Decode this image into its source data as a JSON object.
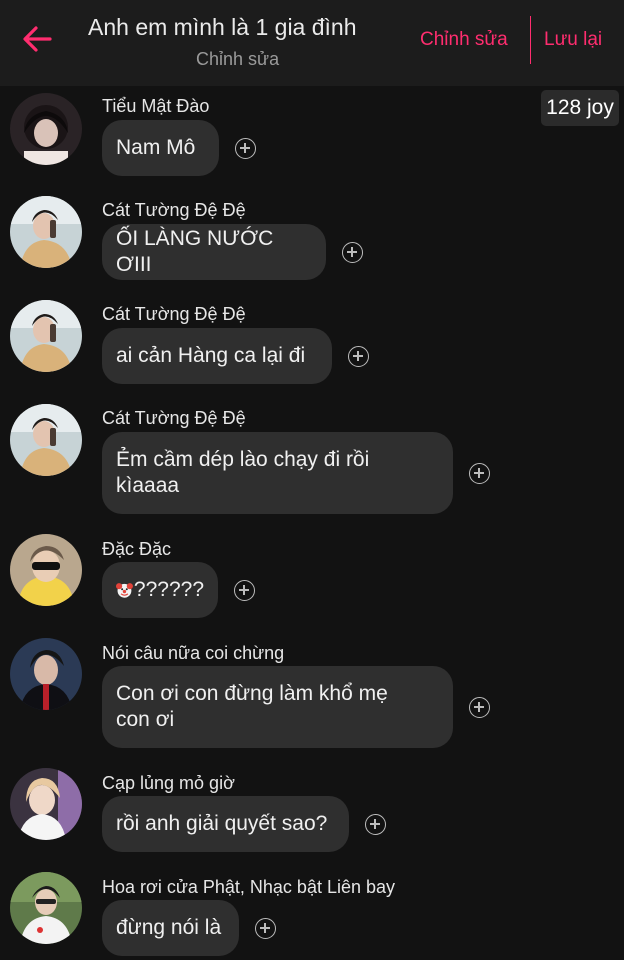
{
  "header": {
    "title": "Anh em mình là 1 gia đình",
    "subtitle": "Chỉnh sửa",
    "edit_label": "Chỉnh sửa",
    "save_label": "Lưu lại",
    "back_icon": "back-arrow-icon",
    "accent_color": "#ff2d6f"
  },
  "badge": {
    "joy": "128 joy"
  },
  "messages": [
    {
      "sender": "Tiểu Mật Đào",
      "text": "Nam Mô"
    },
    {
      "sender": "Cát Tường Đệ Đệ",
      "text": "ỐI LÀNG NƯỚC ƠIII"
    },
    {
      "sender": "Cát Tường Đệ Đệ",
      "text": "ai cản Hàng ca lại đi"
    },
    {
      "sender": "Cát Tường Đệ Đệ",
      "text": "Ẻm cầm dép lào chạy đi rồi\nkìaaaa"
    },
    {
      "sender": "Đặc Đặc",
      "text": "??????",
      "emoji": "clown-face-icon"
    },
    {
      "sender": "Nói câu nữa coi chừng",
      "text": "Con ơi con đừng làm khổ mẹ\ncon ơi"
    },
    {
      "sender": "Cạp lủng mỏ giờ",
      "text": "rồi anh giải quyết sao?"
    },
    {
      "sender": "Hoa rơi cửa Phật, Nhạc bật Liên bay",
      "text": "đừng nói là"
    }
  ]
}
